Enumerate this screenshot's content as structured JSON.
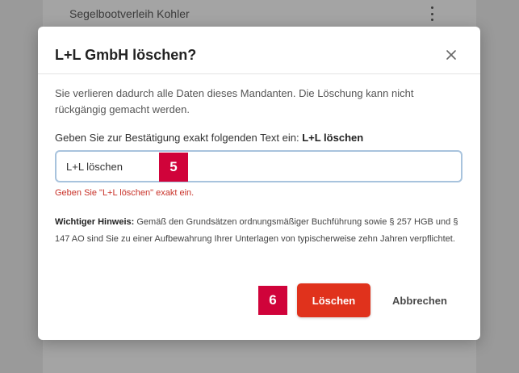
{
  "background": {
    "row_label": "Segelbootverleih Kohler",
    "row_menu_icon": "kebab-vertical-icon"
  },
  "modal": {
    "title": "L+L GmbH löschen?",
    "close_icon": "close-icon",
    "description": "Sie verlieren dadurch alle Daten dieses Mandanten. Die Löschung kann nicht rückgängig gemacht werden.",
    "confirm_label_prefix": "Geben Sie zur Bestätigung exakt folgenden Text ein:",
    "confirm_text": "L+L löschen",
    "input_value": "L+L löschen",
    "error": "Geben Sie \"L+L löschen\" exakt ein.",
    "hint_title": "Wichtiger Hinweis:",
    "hint_body": " Gemäß den Grundsätzen ordnungsmäßiger Buchführung sowie § 257 HGB und § 147 AO sind Sie zu einer Aufbewahrung Ihrer Unterlagen von typischerweise zehn Jahren verpflichtet.",
    "delete_label": "Löschen",
    "cancel_label": "Abbrechen"
  },
  "badges": {
    "input_badge": "5",
    "button_badge": "6"
  },
  "colors": {
    "danger": "#e0321c",
    "badge": "#d0033a",
    "error_text": "#c9332a",
    "input_focus_border": "#a8c3dd"
  }
}
